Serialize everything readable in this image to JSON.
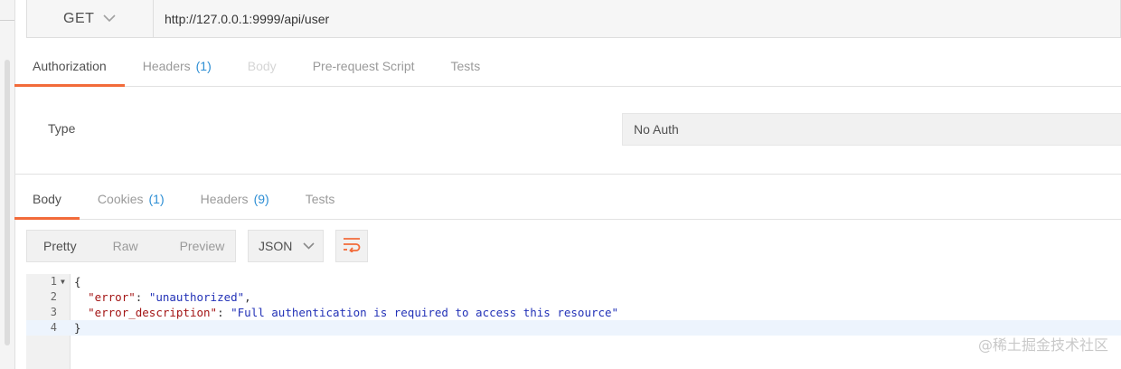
{
  "request": {
    "method": "GET",
    "url": "http://127.0.0.1:9999/api/user"
  },
  "request_tabs": [
    {
      "label": "Authorization",
      "count": ""
    },
    {
      "label": "Headers",
      "count": "(1)"
    },
    {
      "label": "Body",
      "count": ""
    },
    {
      "label": "Pre-request Script",
      "count": ""
    },
    {
      "label": "Tests",
      "count": ""
    }
  ],
  "auth": {
    "type_label": "Type",
    "type_value": "No Auth"
  },
  "response_tabs": [
    {
      "label": "Body",
      "count": ""
    },
    {
      "label": "Cookies",
      "count": "(1)"
    },
    {
      "label": "Headers",
      "count": "(9)"
    },
    {
      "label": "Tests",
      "count": ""
    }
  ],
  "response_toolbar": {
    "views": [
      "Pretty",
      "Raw",
      "Preview"
    ],
    "format": "JSON"
  },
  "code_lines": [
    {
      "num": "1",
      "text": "{"
    },
    {
      "num": "2",
      "key": "\"error\"",
      "value": "\"unauthorized\"",
      "trail": ","
    },
    {
      "num": "3",
      "key": "\"error_description\"",
      "value": "\"Full authentication is required to access this resource\"",
      "trail": ""
    },
    {
      "num": "4",
      "text": "}"
    }
  ],
  "watermark": "@稀土掘金技术社区",
  "colors": {
    "accent": "#f26b3a",
    "count_blue": "#2d8ed4",
    "json_key": "#a31515",
    "json_string": "#2332b7"
  }
}
